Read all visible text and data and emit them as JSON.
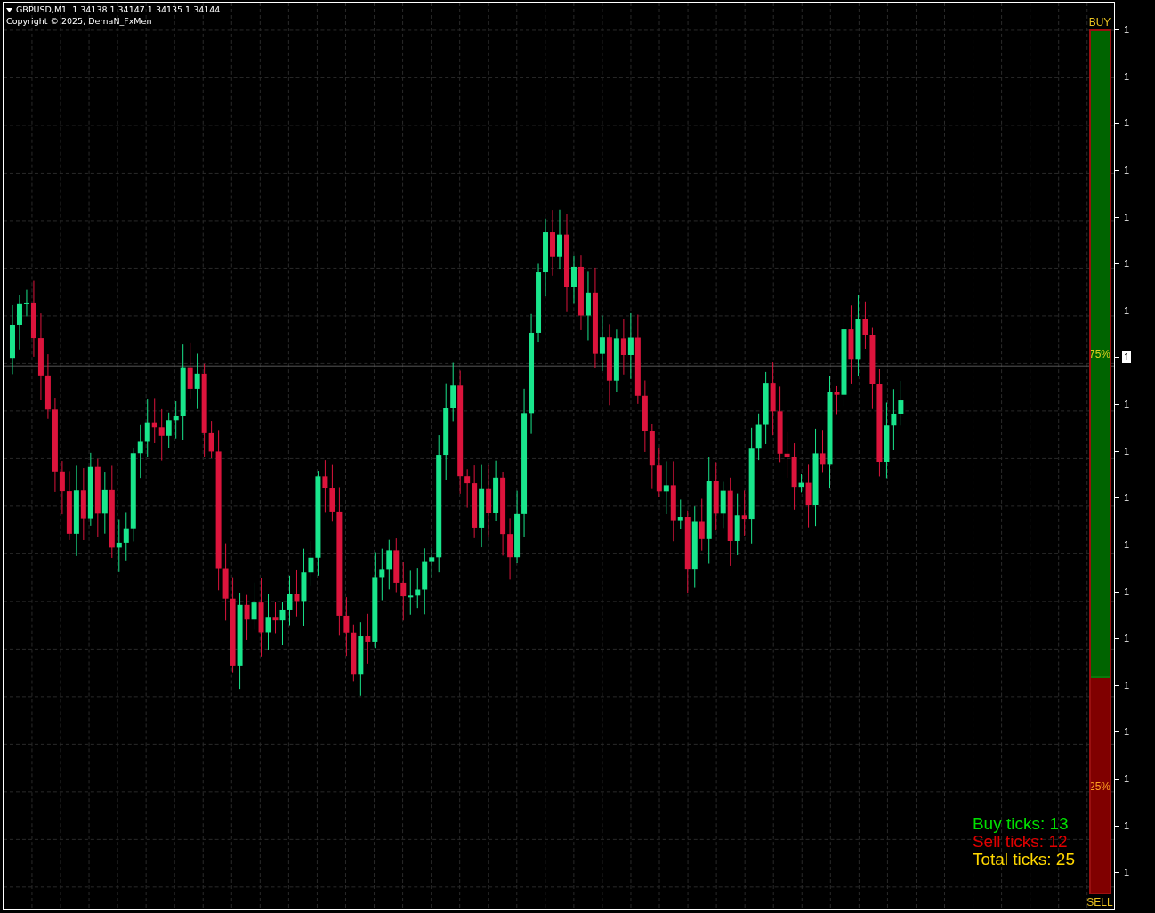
{
  "header": {
    "symbol_line": "GBPUSD,M1  1.34138 1.34147 1.34135 1.34144",
    "copyright": "Copyright © 2025, DemaN_FxMen"
  },
  "meter": {
    "buy_label": "BUY",
    "sell_label": "SELL",
    "level": 0.75,
    "buy_reading": "75%",
    "sell_reading": "25%"
  },
  "tick_counts": [
    {
      "label": "Buy ticks: 13",
      "color": "#00e000"
    },
    {
      "label": "Sell ticks: 12",
      "color": "#e00000"
    },
    {
      "label": "Total ticks: 25",
      "color": "#ffd700"
    }
  ],
  "price_axis": [
    {
      "label": "1",
      "selected": false
    },
    {
      "label": "1",
      "selected": false
    },
    {
      "label": "1",
      "selected": false
    },
    {
      "label": "1",
      "selected": false
    },
    {
      "label": "1",
      "selected": false
    },
    {
      "label": "1",
      "selected": false
    },
    {
      "label": "1",
      "selected": false
    },
    {
      "label": "1",
      "selected": true
    },
    {
      "label": "1",
      "selected": false
    },
    {
      "label": "1",
      "selected": false
    },
    {
      "label": "1",
      "selected": false
    },
    {
      "label": "1",
      "selected": false
    },
    {
      "label": "1",
      "selected": false
    },
    {
      "label": "1",
      "selected": false
    },
    {
      "label": "1",
      "selected": false
    },
    {
      "label": "1",
      "selected": false
    },
    {
      "label": "1",
      "selected": false
    },
    {
      "label": "1",
      "selected": false
    },
    {
      "label": "1",
      "selected": false
    }
  ]
}
